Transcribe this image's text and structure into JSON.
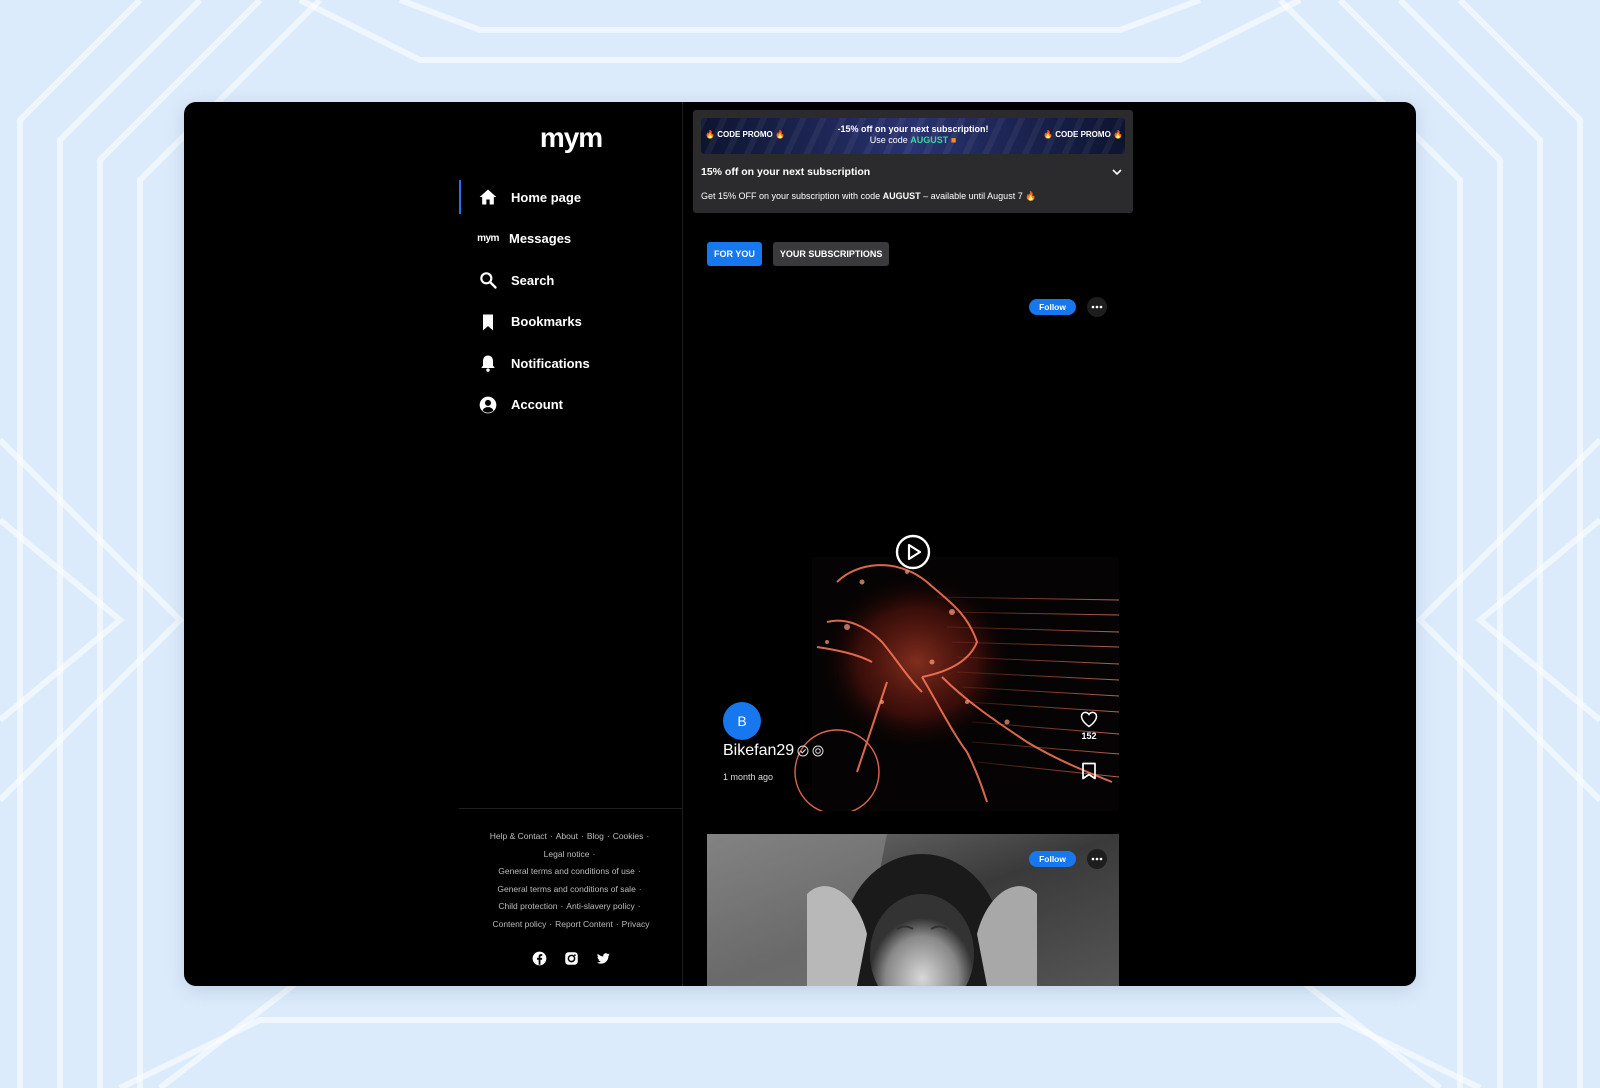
{
  "app": {
    "logo_text": "mym"
  },
  "sidebar": {
    "items": [
      {
        "label": "Home page",
        "icon": "home-icon",
        "active": true
      },
      {
        "label": "Messages",
        "icon": "mym-messages-icon",
        "icon_text": "mym"
      },
      {
        "label": "Search",
        "icon": "search-icon"
      },
      {
        "label": "Bookmarks",
        "icon": "bookmark-icon"
      },
      {
        "label": "Notifications",
        "icon": "bell-icon"
      },
      {
        "label": "Account",
        "icon": "account-icon"
      }
    ],
    "footer_links": [
      "Help & Contact",
      "About",
      "Blog",
      "Cookies",
      "Legal notice",
      "General terms and conditions of use",
      "General terms and conditions of sale",
      "Child protection",
      "Anti-slavery policy",
      "Content policy",
      "Report Content",
      "Privacy"
    ],
    "socials": [
      "facebook-icon",
      "instagram-icon",
      "twitter-icon"
    ]
  },
  "promo": {
    "banner_side_label": "CODE PROMO",
    "banner_line1": "-15% off on your next subscription!",
    "banner_line2_prefix": "Use code",
    "banner_code": "AUGUST",
    "title": "15% off on your next subscription",
    "desc_prefix": "Get 15% OFF on your subscription with code",
    "desc_code": "AUGUST",
    "desc_suffix": "– available until August 7"
  },
  "tabs": [
    {
      "label": "FOR YOU",
      "active": true
    },
    {
      "label": "YOUR SUBSCRIPTIONS",
      "active": false
    }
  ],
  "posts": [
    {
      "follow_label": "Follow",
      "avatar_letter": "B",
      "username": "Bikefan29",
      "time": "1 month ago",
      "likes": "152"
    },
    {
      "follow_label": "Follow"
    }
  ],
  "colors": {
    "accent": "#1677ee",
    "active_indicator": "#2d6ef0",
    "background": "#000000",
    "promo_card": "#2b2b2d"
  }
}
